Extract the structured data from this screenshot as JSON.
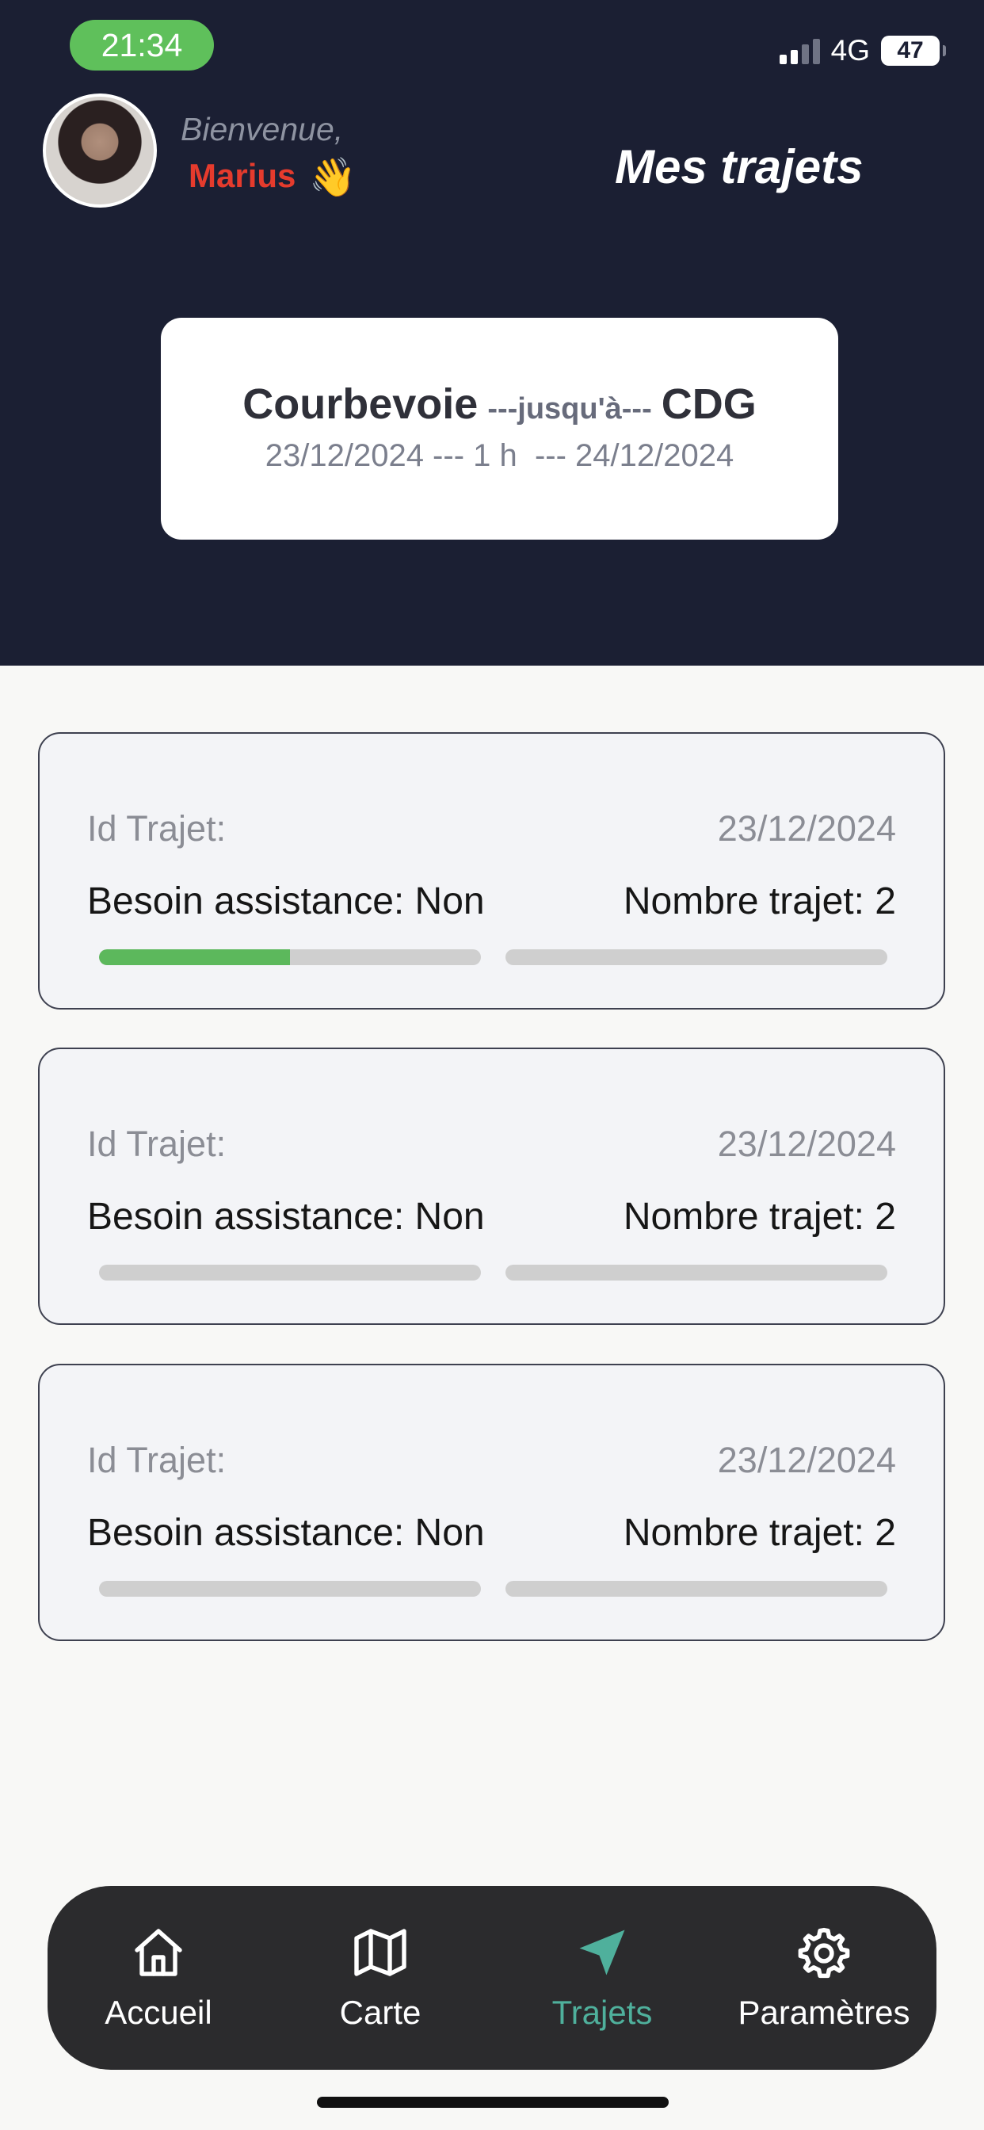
{
  "status_bar": {
    "time": "21:34",
    "network": "4G",
    "battery": "47"
  },
  "header": {
    "greeting": "Bienvenue,",
    "username": "Marius",
    "wave_emoji": "👋",
    "title": "Mes trajets"
  },
  "route": {
    "from": "Courbevoie",
    "separator": "---jusqu'à---",
    "to": "CDG",
    "dates": "23/12/2024 --- 1 h  --- 24/12/2024"
  },
  "trips": [
    {
      "id_label": "Id Trajet:",
      "date": "23/12/2024",
      "assistance": "Besoin assistance: Non",
      "count": "Nombre trajet: 2",
      "progress_left": 0.5,
      "progress_right": 0
    },
    {
      "id_label": "Id Trajet:",
      "date": "23/12/2024",
      "assistance": "Besoin assistance: Non",
      "count": "Nombre trajet: 2",
      "progress_left": 0,
      "progress_right": 0
    },
    {
      "id_label": "Id Trajet:",
      "date": "23/12/2024",
      "assistance": "Besoin assistance: Non",
      "count": "Nombre trajet: 2",
      "progress_left": 0,
      "progress_right": 0
    }
  ],
  "nav": {
    "items": [
      {
        "label": "Accueil",
        "icon": "home-icon"
      },
      {
        "label": "Carte",
        "icon": "map-icon"
      },
      {
        "label": "Trajets",
        "icon": "navigation-icon"
      },
      {
        "label": "Paramètres",
        "icon": "gear-icon"
      }
    ],
    "active": "Trajets"
  },
  "colors": {
    "header_bg": "#1b1f33",
    "accent": "#4fb09c",
    "progress": "#5cb85c",
    "username": "#e53b2d"
  }
}
